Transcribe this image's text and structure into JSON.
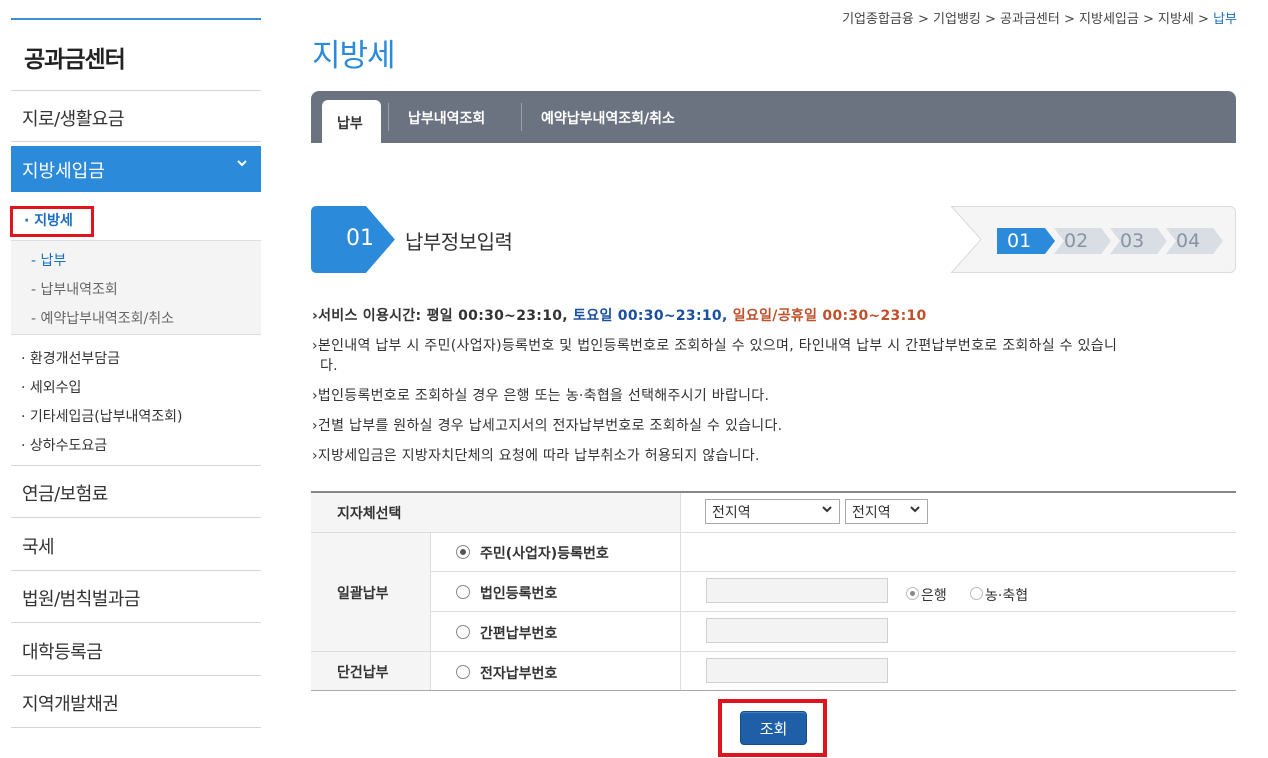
{
  "sidebar": {
    "title": "공과금센터",
    "items": [
      "지로/생활요금",
      "지방세입금",
      "연금/보험료",
      "국세",
      "법원/범칙벌과금",
      "대학등록금",
      "지역개발채권"
    ],
    "active_chevron": "⌄",
    "sub_active": "· 지방세",
    "sub_items": [
      "- 납부",
      "- 납부내역조회",
      "- 예약납부내역조회/취소"
    ],
    "other_subs": [
      "· 환경개선부담금",
      "· 세외수입",
      "· 기타세입금(납부내역조회)",
      "· 상하수도요금"
    ]
  },
  "breadcrumb": {
    "items": [
      "기업종합금융",
      "기업뱅킹",
      "공과금센터",
      "지방세입금",
      "지방세"
    ],
    "current": "납부",
    "separator": " > "
  },
  "page_title": "지방세",
  "tabs": [
    "납부",
    "납부내역조회",
    "예약납부내역조회/취소"
  ],
  "step": {
    "number": "01",
    "title": "납부정보입력",
    "indicators": [
      "01",
      "02",
      "03",
      "04"
    ]
  },
  "notices": {
    "service_prefix": "서비스 이용시간: 평일 00:30~23:10, ",
    "service_sat": "토요일 00:30~23:10, ",
    "service_sun": "일요일/공휴일 00:30~23:10",
    "lines": [
      "본인내역 납부 시 주민(사업자)등록번호 및 법인등록번호로 조회하실 수 있으며, 타인내역 납부 시 간편납부번호로 조회하실 수 있습니",
      "다.",
      "법인등록번호로 조회하실 경우 은행 또는 농·축협을 선택해주시기 바랍니다.",
      "건별 납부를 원하실 경우 납세고지서의 전자납부번호로 조회하실 수 있습니다.",
      "지방세입금은 지방자치단체의 요청에 따라 납부취소가 허용되지 않습니다."
    ],
    "colors": {
      "sat": "#1a4fa0",
      "sun": "#c0502a"
    }
  },
  "form": {
    "region_label": "지자체선택",
    "region_select1": "전지역",
    "region_select2": "전지역",
    "bulk_label": "일괄납부",
    "single_label": "단건납부",
    "options": [
      "주민(사업자)등록번호",
      "법인등록번호",
      "간편납부번호",
      "전자납부번호"
    ],
    "bank_options": [
      "은행",
      "농·축협"
    ]
  },
  "search_button": "조회",
  "colors": {
    "accent": "#2b8ad9",
    "tabbar": "#6b7280",
    "highlight": "#e0141c",
    "button": "#1f5fa8"
  }
}
